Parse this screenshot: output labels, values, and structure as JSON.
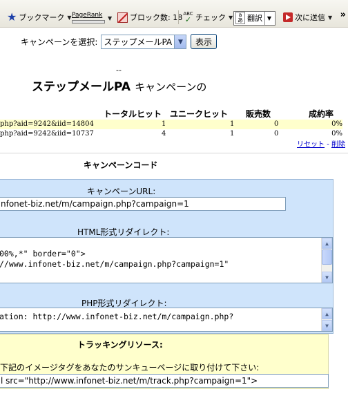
{
  "toolbar": {
    "bookmarks_label": "ブックマーク",
    "pagerank_label": "PageRank",
    "popup_blocked_label": "ブロック数: 18",
    "spellcheck_label": "チェック",
    "spellcheck_icon_text": "ABC",
    "translate_icon_top": "a",
    "translate_icon_bottom": "あ",
    "translate_label": "翻訳",
    "send_label": "次に送信",
    "more_label": "»"
  },
  "campaign_select": {
    "label": "キャンペーンを選択:",
    "selected": "ステップメールPA",
    "show_button": "表示"
  },
  "title": {
    "dash": "--",
    "bold": "ステップメールPA",
    "rest": "キャンペーンの"
  },
  "stats": {
    "headers": [
      "トータルヒット",
      "ユニークヒット",
      "販売数",
      "成約率"
    ],
    "rows": [
      {
        "page": "php?aid=9242&iid=14804",
        "total_hits": "1",
        "unique_hits": "1",
        "sales": "0",
        "rate": "0%"
      },
      {
        "page": "php?aid=9242&iid=10737",
        "total_hits": "4",
        "unique_hits": "1",
        "sales": "0",
        "rate": "0%"
      }
    ],
    "reset_link": "リセット",
    "link_separator": "-",
    "delete_link": "削除"
  },
  "campaign_code": {
    "title": "キャンペーンコード",
    "url_label": "キャンペーンURL:",
    "url_value": "nfonet-biz.net/m/campaign.php?campaign=1",
    "html_label": "HTML形式リダイレクト:",
    "html_lines": [
      "00%,*\" border=\"0\">",
      "//www.infonet-biz.net/m/campaign.php?campaign=1\""
    ],
    "php_label": "PHP形式リダイレクト:",
    "php_line": "ation: http://www.infonet-biz.net/m/campaign.php?"
  },
  "tracking": {
    "title": "トラッキングリソース:",
    "description": "下記のイメージタグをあなたのサンキューページに取り付けて下さい:",
    "tag_value": "l src=\"http://www.infonet-biz.net/m/track.php?campaign=1\">"
  },
  "colors": {
    "code_panel_bg": "#cfe4fb",
    "tracking_bg": "#ffffcc",
    "highlight_row": "#ffffcc",
    "link": "#0000cc"
  }
}
